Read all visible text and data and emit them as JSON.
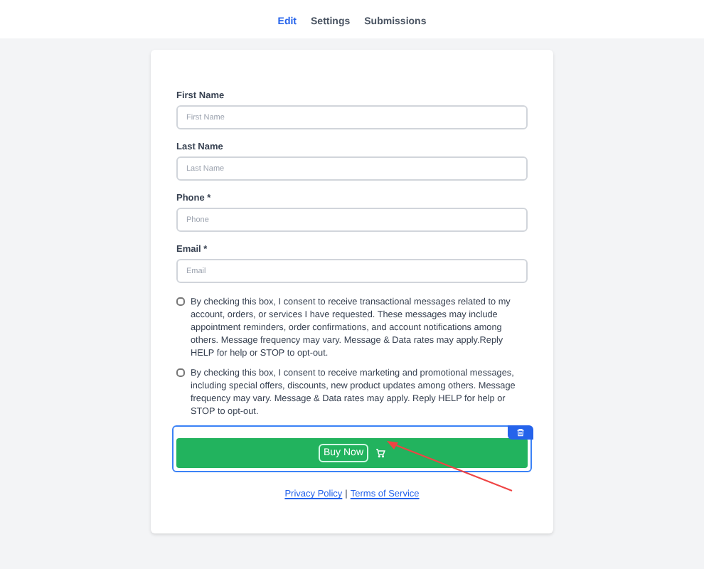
{
  "tabs": [
    {
      "label": "Edit",
      "selected": true
    },
    {
      "label": "Settings",
      "selected": false
    },
    {
      "label": "Submissions",
      "selected": false
    }
  ],
  "fields": [
    {
      "label": "First Name",
      "placeholder": "First Name"
    },
    {
      "label": "Last Name",
      "placeholder": "Last Name"
    },
    {
      "label": "Phone *",
      "placeholder": "Phone"
    },
    {
      "label": "Email *",
      "placeholder": "Email"
    }
  ],
  "consents": [
    {
      "checked": false,
      "text": "By checking this box, I consent to receive transactional messages related to my account, orders, or services I have requested. These messages may include appointment reminders, order confirmations, and account notifications among others. Message frequency may vary. Message & Data rates may apply.Reply HELP for help or STOP to opt-out."
    },
    {
      "checked": false,
      "text": "By checking this box, I consent to receive marketing and promotional messages, including special offers, discounts, new product updates among others. Message frequency may vary. Message & Data rates may apply. Reply HELP for help or STOP to opt-out."
    }
  ],
  "buy_button": {
    "label": "Buy Now",
    "selected": true
  },
  "footer_links": [
    "Privacy Policy",
    "Terms of Service"
  ],
  "footer_separator": "|"
}
